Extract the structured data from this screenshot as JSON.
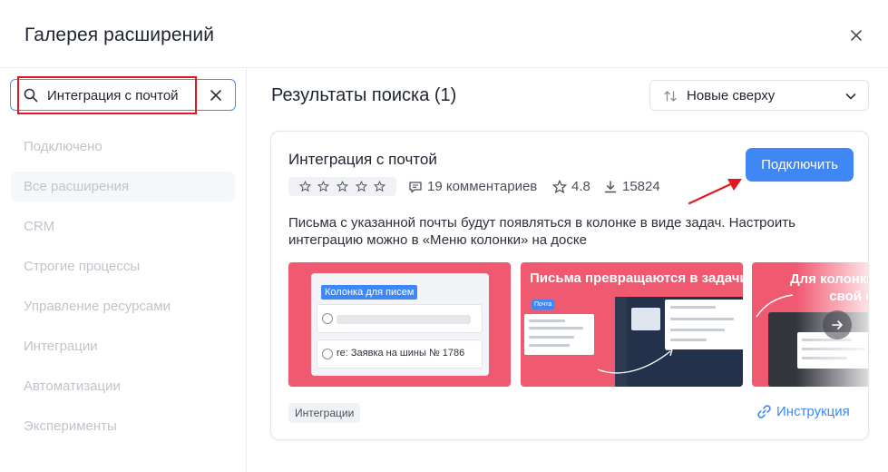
{
  "header": {
    "title": "Галерея расширений",
    "close_icon": "close-icon"
  },
  "sidebar": {
    "search": {
      "value": "Интеграция с почтой",
      "placeholder": "Поиск"
    },
    "items": [
      {
        "label": "Подключено",
        "active": false
      },
      {
        "label": "Все расширения",
        "active": true
      },
      {
        "label": "CRM",
        "active": false
      },
      {
        "label": "Строгие процессы",
        "active": false
      },
      {
        "label": "Управление ресурсами",
        "active": false
      },
      {
        "label": "Интеграции",
        "active": false
      },
      {
        "label": "Автоматизации",
        "active": false
      },
      {
        "label": "Эксперименты",
        "active": false
      }
    ]
  },
  "main": {
    "results_title": "Результаты поиска (1)",
    "sort": {
      "selected": "Новые сверху"
    },
    "extension": {
      "title": "Интеграция с почтой",
      "stars": 5,
      "comments": "19 комментариев",
      "rating": "4.8",
      "downloads": "15824",
      "connect_label": "Подключить",
      "description": "Письма с указанной почты будут появляться в колонке в виде задач. Настроить интеграцию можно в «Меню колонки» на доске",
      "screenshots": [
        {
          "chip": "Колонка для писем",
          "row_text": "re: Заявка на шины № 1786"
        },
        {
          "heading": "Письма превращаются в задачи",
          "chip": "Почта"
        },
        {
          "heading_line1": "Для колонки",
          "heading_line2": "свой е"
        }
      ],
      "tag": "Интеграции",
      "instruction_label": "Инструкция"
    }
  },
  "colors": {
    "accent": "#3f87f5",
    "screenshot_bg": "#f05a71",
    "annotation_red": "#e2171f"
  }
}
